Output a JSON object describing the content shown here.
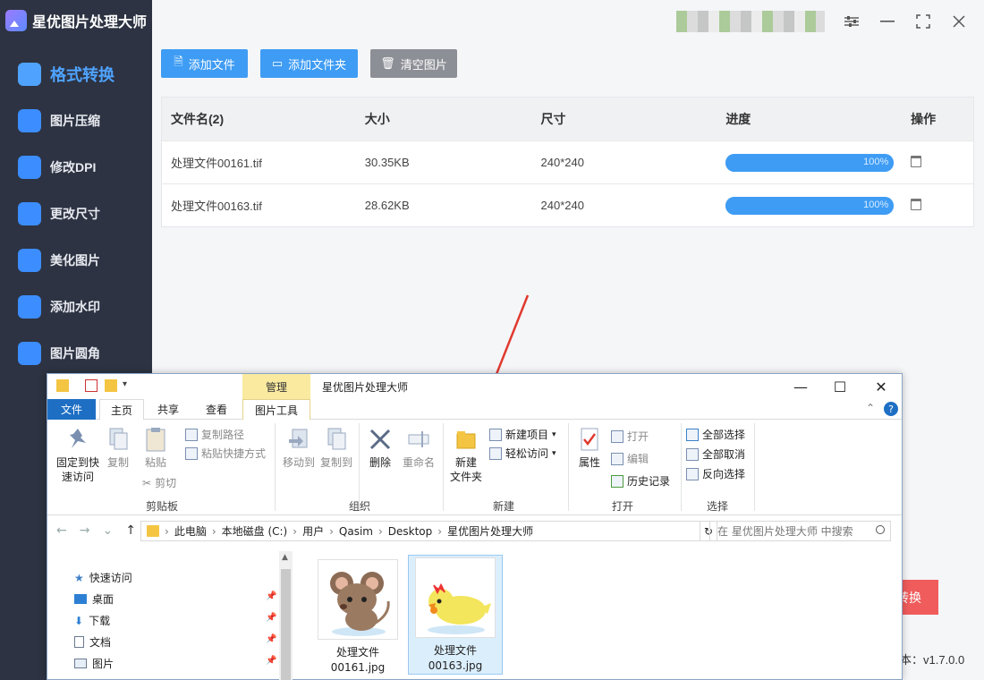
{
  "app": {
    "title": "星优图片处理大师",
    "accent": "#3e9cf4",
    "sidebar_bg": "#2d3342"
  },
  "sidebar": {
    "items": [
      {
        "label": "格式转换",
        "active": true
      },
      {
        "label": "图片压缩"
      },
      {
        "label": "修改DPI"
      },
      {
        "label": "更改尺寸"
      },
      {
        "label": "美化图片"
      },
      {
        "label": "添加水印"
      },
      {
        "label": "图片圆角"
      }
    ]
  },
  "toolbar": {
    "add_file": "添加文件",
    "add_folder": "添加文件夹",
    "clear": "清空图片"
  },
  "table": {
    "headers": [
      "文件名(2)",
      "大小",
      "尺寸",
      "进度",
      "操作"
    ],
    "rows": [
      {
        "name": "处理文件00161.tif",
        "size": "30.35KB",
        "dims": "240*240",
        "progress": "100%"
      },
      {
        "name": "处理文件00163.tif",
        "size": "28.62KB",
        "dims": "240*240",
        "progress": "100%"
      }
    ]
  },
  "convert_label": "转换",
  "version": "本：v1.7.0.0",
  "explorer": {
    "manage_tab": "管理",
    "window_title": "星优图片处理大师",
    "tabs": {
      "file": "文件",
      "home": "主页",
      "share": "共享",
      "view": "查看",
      "picture_tools": "图片工具"
    },
    "ribbon": {
      "pin_quick": "固定到快\n速访问",
      "copy": "复制",
      "paste": "粘贴",
      "copy_path": "复制路径",
      "paste_shortcut": "粘贴快捷方式",
      "cut": "剪切",
      "group_clipboard": "剪贴板",
      "move_to": "移动到",
      "copy_to": "复制到",
      "delete": "删除",
      "rename": "重命名",
      "group_organize": "组织",
      "new_item": "新建项目",
      "easy_access": "轻松访问",
      "new_folder": "新建\n文件夹",
      "group_new": "新建",
      "properties": "属性",
      "open": "打开",
      "edit": "编辑",
      "history": "历史记录",
      "group_open": "打开",
      "select_all": "全部选择",
      "select_none": "全部取消",
      "invert": "反向选择",
      "group_select": "选择"
    },
    "address": {
      "parts": [
        "此电脑",
        "本地磁盘 (C:)",
        "用户",
        "Qasim",
        "Desktop",
        "星优图片处理大师"
      ],
      "search_placeholder": "在 星优图片处理大师 中搜索"
    },
    "tree": [
      "快速访问",
      "桌面",
      "下载",
      "文档",
      "图片"
    ],
    "files": [
      {
        "name": "处理文件\n00161.jpg"
      },
      {
        "name": "处理文件\n00163.jpg",
        "selected": true
      }
    ]
  }
}
